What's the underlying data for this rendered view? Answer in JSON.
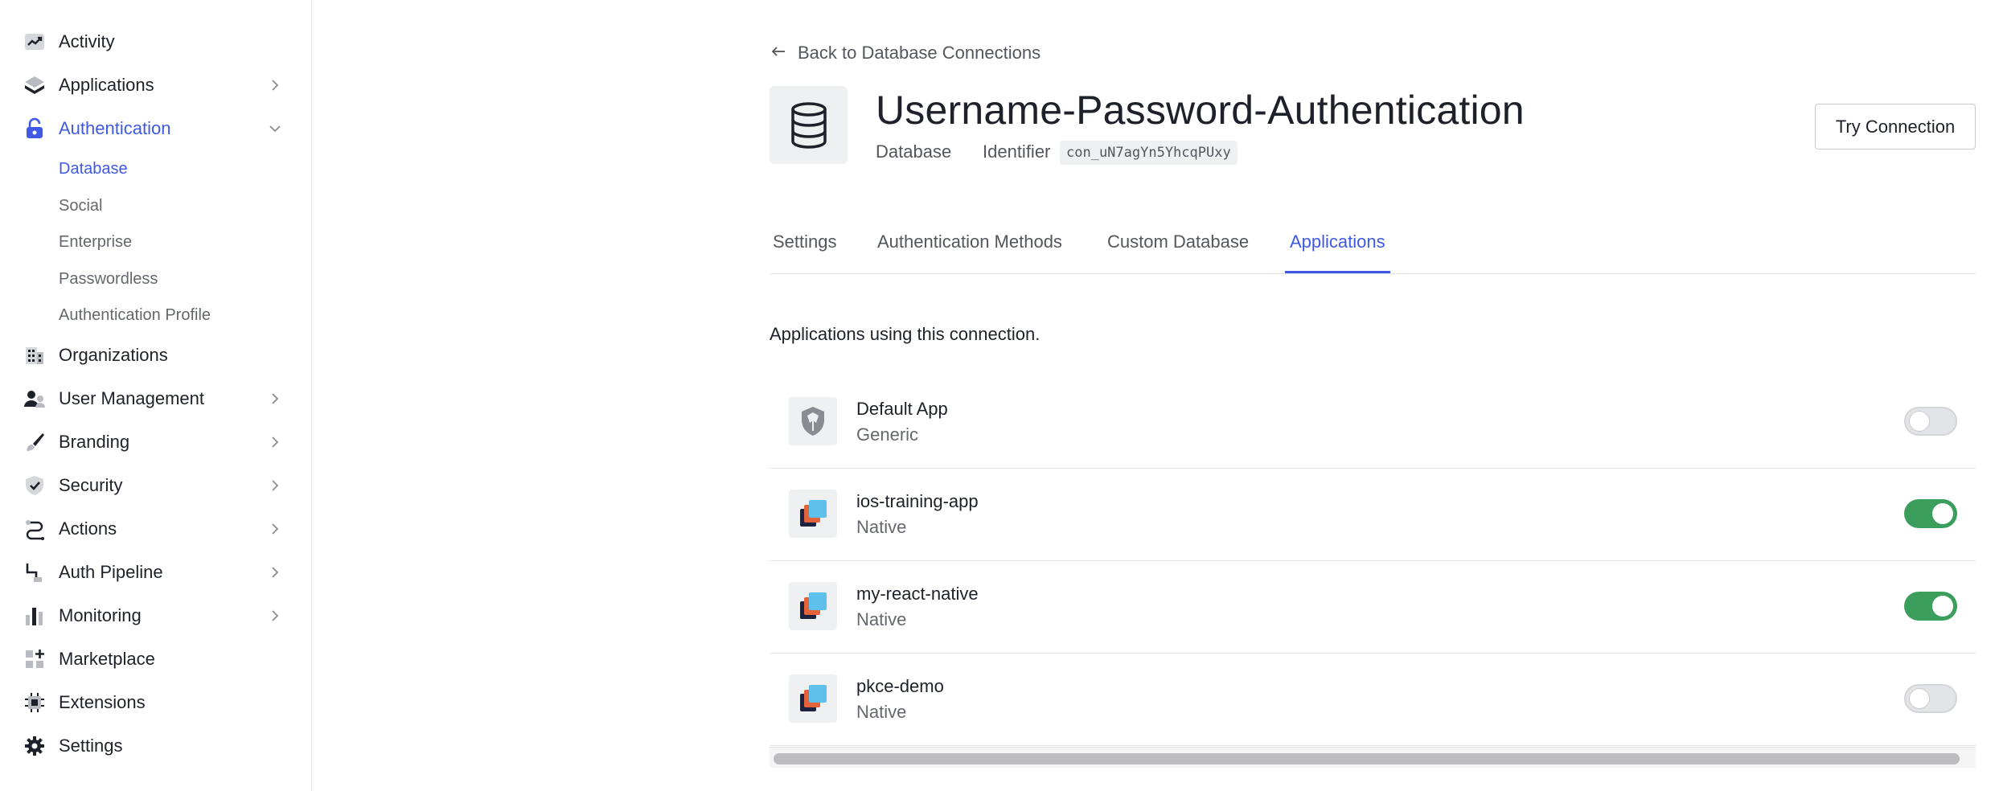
{
  "sidebar": {
    "items": [
      {
        "label": "Activity",
        "icon": "activity-icon"
      },
      {
        "label": "Applications",
        "icon": "applications-icon"
      },
      {
        "label": "Authentication",
        "icon": "lock-icon"
      },
      {
        "label": "Organizations",
        "icon": "organizations-icon"
      },
      {
        "label": "User Management",
        "icon": "users-icon"
      },
      {
        "label": "Branding",
        "icon": "brush-icon"
      },
      {
        "label": "Security",
        "icon": "shield-icon"
      },
      {
        "label": "Actions",
        "icon": "actions-icon"
      },
      {
        "label": "Auth Pipeline",
        "icon": "pipeline-icon"
      },
      {
        "label": "Monitoring",
        "icon": "bar-chart-icon"
      },
      {
        "label": "Marketplace",
        "icon": "marketplace-icon"
      },
      {
        "label": "Extensions",
        "icon": "chip-icon"
      },
      {
        "label": "Settings",
        "icon": "gear-icon"
      }
    ],
    "auth_sub": [
      "Database",
      "Social",
      "Enterprise",
      "Passwordless",
      "Authentication Profile"
    ],
    "active_sub": "Database",
    "accent": "#3f59e4"
  },
  "main": {
    "back_label": "Back to Database Connections",
    "title": "Username-Password-Authentication",
    "type_label": "Database",
    "identifier_label": "Identifier",
    "identifier_value": "con_uN7agYn5YhcqPUxy",
    "try_button": "Try Connection",
    "tabs": [
      "Settings",
      "Authentication Methods",
      "Custom Database",
      "Applications"
    ],
    "active_tab": "Applications",
    "section_desc": "Applications using this connection.",
    "apps": [
      {
        "name": "Default App",
        "type": "Generic",
        "enabled": false,
        "icon": "shield-logo-icon"
      },
      {
        "name": "ios-training-app",
        "type": "Native",
        "enabled": true,
        "icon": "native-app-icon"
      },
      {
        "name": "my-react-native",
        "type": "Native",
        "enabled": true,
        "icon": "native-app-icon"
      },
      {
        "name": "pkce-demo",
        "type": "Native",
        "enabled": false,
        "icon": "native-app-icon"
      }
    ],
    "toggle_on_color": "#3c9e5c"
  }
}
